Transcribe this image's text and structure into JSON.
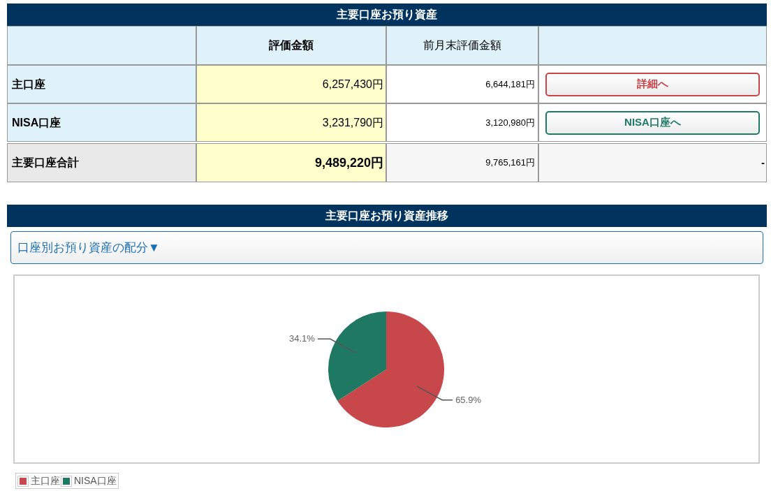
{
  "assets": {
    "title": "主要口座お預り資産",
    "columns": [
      "評価金額",
      "前月末評価金額"
    ],
    "rows": [
      {
        "label": "主口座",
        "value": "6,257,430円",
        "previous": "6,644,181円",
        "button": {
          "label": "詳細へ",
          "color": "#c9444a"
        }
      },
      {
        "label": "NISA口座",
        "value": "3,231,790円",
        "previous": "3,120,980円",
        "button": {
          "label": "NISA口座へ",
          "color": "#1d7a63"
        }
      }
    ],
    "total": {
      "label": "主要口座合計",
      "value": "9,489,220円",
      "previous": "9,765,161円",
      "action": "-"
    }
  },
  "trend": {
    "title": "主要口座お預り資産推移",
    "accordion": {
      "label": "口座別お預り資産の配分▼"
    },
    "chart_data": {
      "type": "pie",
      "categories": [
        "主口座",
        "NISA口座"
      ],
      "values": [
        65.9,
        34.1
      ],
      "colors": [
        "#c8474b",
        "#1f7962"
      ],
      "value_labels": [
        "65.9%",
        "34.1%"
      ]
    }
  }
}
